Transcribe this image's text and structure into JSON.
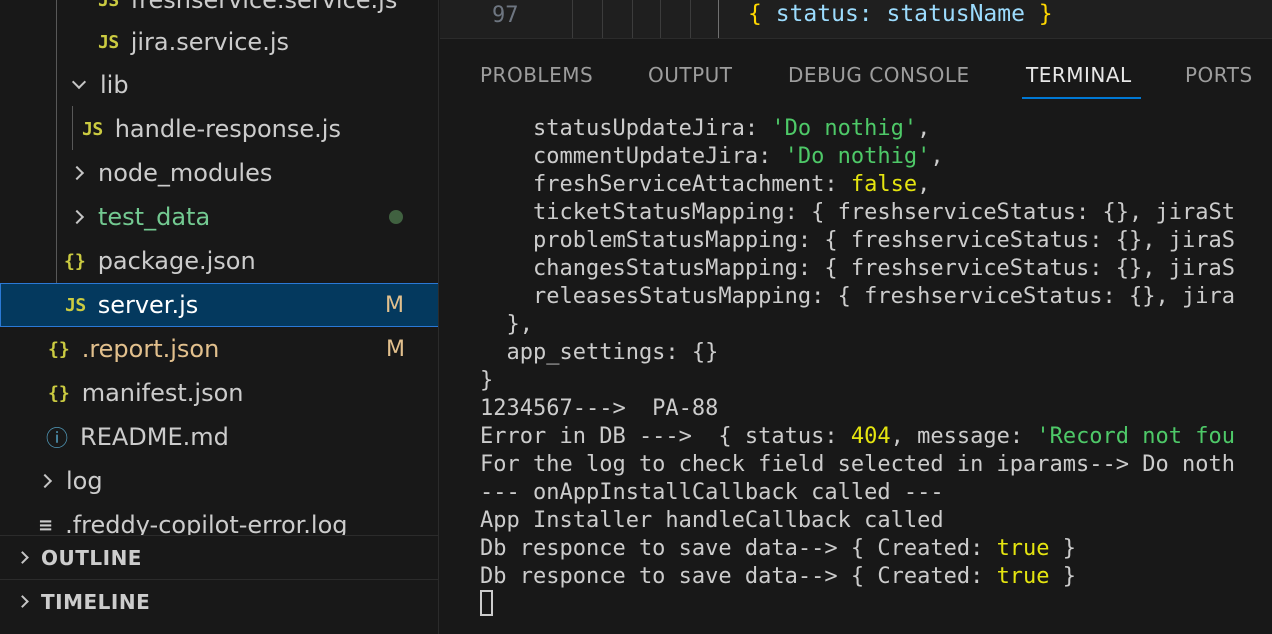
{
  "explorer": {
    "items": [
      {
        "label": "freshservice.service.js",
        "icon": "js-file-icon",
        "icon_text": "JS",
        "badge": ""
      },
      {
        "label": "jira.service.js",
        "icon": "js-file-icon",
        "icon_text": "JS",
        "badge": ""
      },
      {
        "label": "lib",
        "icon": "chevron-down-icon",
        "badge": ""
      },
      {
        "label": "handle-response.js",
        "icon": "js-file-icon",
        "icon_text": "JS",
        "badge": ""
      },
      {
        "label": "node_modules",
        "icon": "chevron-right-icon",
        "badge": ""
      },
      {
        "label": "test_data",
        "icon": "chevron-right-icon",
        "badge": "dot"
      },
      {
        "label": "package.json",
        "icon": "json-file-icon",
        "icon_text": "{}",
        "badge": ""
      },
      {
        "label": "server.js",
        "icon": "js-file-icon",
        "icon_text": "JS",
        "badge": "M"
      },
      {
        "label": ".report.json",
        "icon": "json-file-icon",
        "icon_text": "{}",
        "badge": "M"
      },
      {
        "label": "manifest.json",
        "icon": "json-file-icon",
        "icon_text": "{}",
        "badge": ""
      },
      {
        "label": "README.md",
        "icon": "info-icon",
        "icon_text": "ⓘ",
        "badge": ""
      },
      {
        "label": "log",
        "icon": "chevron-right-icon",
        "badge": ""
      },
      {
        "label": ".freddy-copilot-error.log",
        "icon": "lines-icon",
        "icon_text": "≡",
        "badge": ""
      }
    ],
    "sections": [
      {
        "label": "OUTLINE"
      },
      {
        "label": "TIMELINE"
      }
    ]
  },
  "editor": {
    "line_number": "97",
    "code": "{ status: statusName }"
  },
  "panel": {
    "tabs": [
      {
        "label": "PROBLEMS"
      },
      {
        "label": "OUTPUT"
      },
      {
        "label": "DEBUG CONSOLE"
      },
      {
        "label": "TERMINAL"
      },
      {
        "label": "PORTS"
      }
    ],
    "active_tab": "TERMINAL"
  },
  "terminal": {
    "lines": [
      {
        "a": "    statusUpdateJira: ",
        "b": "'Do nothig'",
        "b_type": "s",
        "c": ","
      },
      {
        "a": "    commentUpdateJira: ",
        "b": "'Do nothig'",
        "b_type": "s",
        "c": ","
      },
      {
        "a": "    freshServiceAttachment: ",
        "b": "false",
        "b_type": "y",
        "c": ","
      },
      {
        "a": "    ticketStatusMapping: { freshserviceStatus: {}, jiraSt",
        "b": "",
        "b_type": "",
        "c": ""
      },
      {
        "a": "    problemStatusMapping: { freshserviceStatus: {}, jiraS",
        "b": "",
        "b_type": "",
        "c": ""
      },
      {
        "a": "    changesStatusMapping: { freshserviceStatus: {}, jiraS",
        "b": "",
        "b_type": "",
        "c": ""
      },
      {
        "a": "    releasesStatusMapping: { freshserviceStatus: {}, jira",
        "b": "",
        "b_type": "",
        "c": ""
      },
      {
        "a": "  },",
        "b": "",
        "b_type": "",
        "c": ""
      },
      {
        "a": "  app_settings: {}",
        "b": "",
        "b_type": "",
        "c": ""
      },
      {
        "a": "}",
        "b": "",
        "b_type": "",
        "c": ""
      },
      {
        "a": "1234567--->  PA-88",
        "b": "",
        "b_type": "",
        "c": ""
      },
      {
        "a": "Error in DB --->  { status: ",
        "b": "404",
        "b_type": "y",
        "c": ", message: ",
        "d": "'Record not fou",
        "d_type": "s"
      },
      {
        "a": "For the log to check field selected in iparams--> Do noth",
        "b": "",
        "b_type": "",
        "c": ""
      },
      {
        "a": "--- onAppInstallCallback called ---",
        "b": "",
        "b_type": "",
        "c": ""
      },
      {
        "a": "App Installer handleCallback called",
        "b": "",
        "b_type": "",
        "c": ""
      },
      {
        "a": "Db responce to save data--> { Created: ",
        "b": "true",
        "b_type": "y",
        "c": " }"
      },
      {
        "a": "Db responce to save data--> { Created: ",
        "b": "true",
        "b_type": "y",
        "c": " }"
      }
    ]
  }
}
